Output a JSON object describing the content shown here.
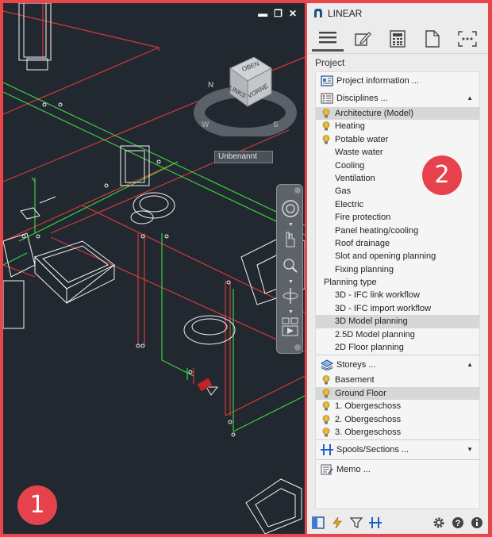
{
  "viewport": {
    "window_controls": [
      "▬",
      "❐",
      "✕"
    ],
    "navcube": {
      "top_label": "OBEN",
      "left_label": "LINKS",
      "right_label": "VORNE",
      "compass": [
        "N",
        "W",
        "S"
      ]
    },
    "view_name": "Unbenannt",
    "callout": "1"
  },
  "panel": {
    "title": "LINEAR",
    "tabs": [
      "menu-icon",
      "pencil-icon",
      "calculator-icon",
      "document-icon",
      "more-icon"
    ],
    "section": "Project",
    "project_info": "Project information ...",
    "disciplines_label": "Disciplines ...",
    "disciplines": [
      {
        "label": "Architecture (Model)",
        "bulb": true,
        "selected": true
      },
      {
        "label": "Heating",
        "bulb": true,
        "selected": false
      },
      {
        "label": "Potable water",
        "bulb": true,
        "selected": false
      },
      {
        "label": "Waste water",
        "bulb": false,
        "selected": false
      },
      {
        "label": "Cooling",
        "bulb": false,
        "selected": false
      },
      {
        "label": "Ventilation",
        "bulb": false,
        "selected": false
      },
      {
        "label": "Gas",
        "bulb": false,
        "selected": false
      },
      {
        "label": "Electric",
        "bulb": false,
        "selected": false
      },
      {
        "label": "Fire protection",
        "bulb": false,
        "selected": false
      },
      {
        "label": "Panel heating/cooling",
        "bulb": false,
        "selected": false
      },
      {
        "label": "Roof drainage",
        "bulb": false,
        "selected": false
      },
      {
        "label": "Slot and opening planning",
        "bulb": false,
        "selected": false
      },
      {
        "label": "Fixing planning",
        "bulb": false,
        "selected": false
      }
    ],
    "planning_type_label": "Planning type",
    "planning_types": [
      {
        "label": "3D - IFC link workflow",
        "selected": false
      },
      {
        "label": "3D - IFC import workflow",
        "selected": false
      },
      {
        "label": "3D Model planning",
        "selected": true
      },
      {
        "label": "2.5D Model planning",
        "selected": false
      },
      {
        "label": "2D Floor planning",
        "selected": false
      }
    ],
    "storeys_label": "Storeys ...",
    "storeys": [
      {
        "label": "Basement",
        "selected": false
      },
      {
        "label": "Ground Floor",
        "selected": true
      },
      {
        "label": "1. Obergeschoss",
        "selected": false
      },
      {
        "label": "2. Obergeschoss",
        "selected": false
      },
      {
        "label": "3. Obergeschoss",
        "selected": false
      }
    ],
    "spools_label": "Spools/Sections ...",
    "memo_label": "Memo ...",
    "callout": "2"
  },
  "colors": {
    "accent_red": "#e5424d",
    "bulb": "#e8b93a",
    "selected_row": "#d7d7d7",
    "viewport_bg": "#212830"
  }
}
